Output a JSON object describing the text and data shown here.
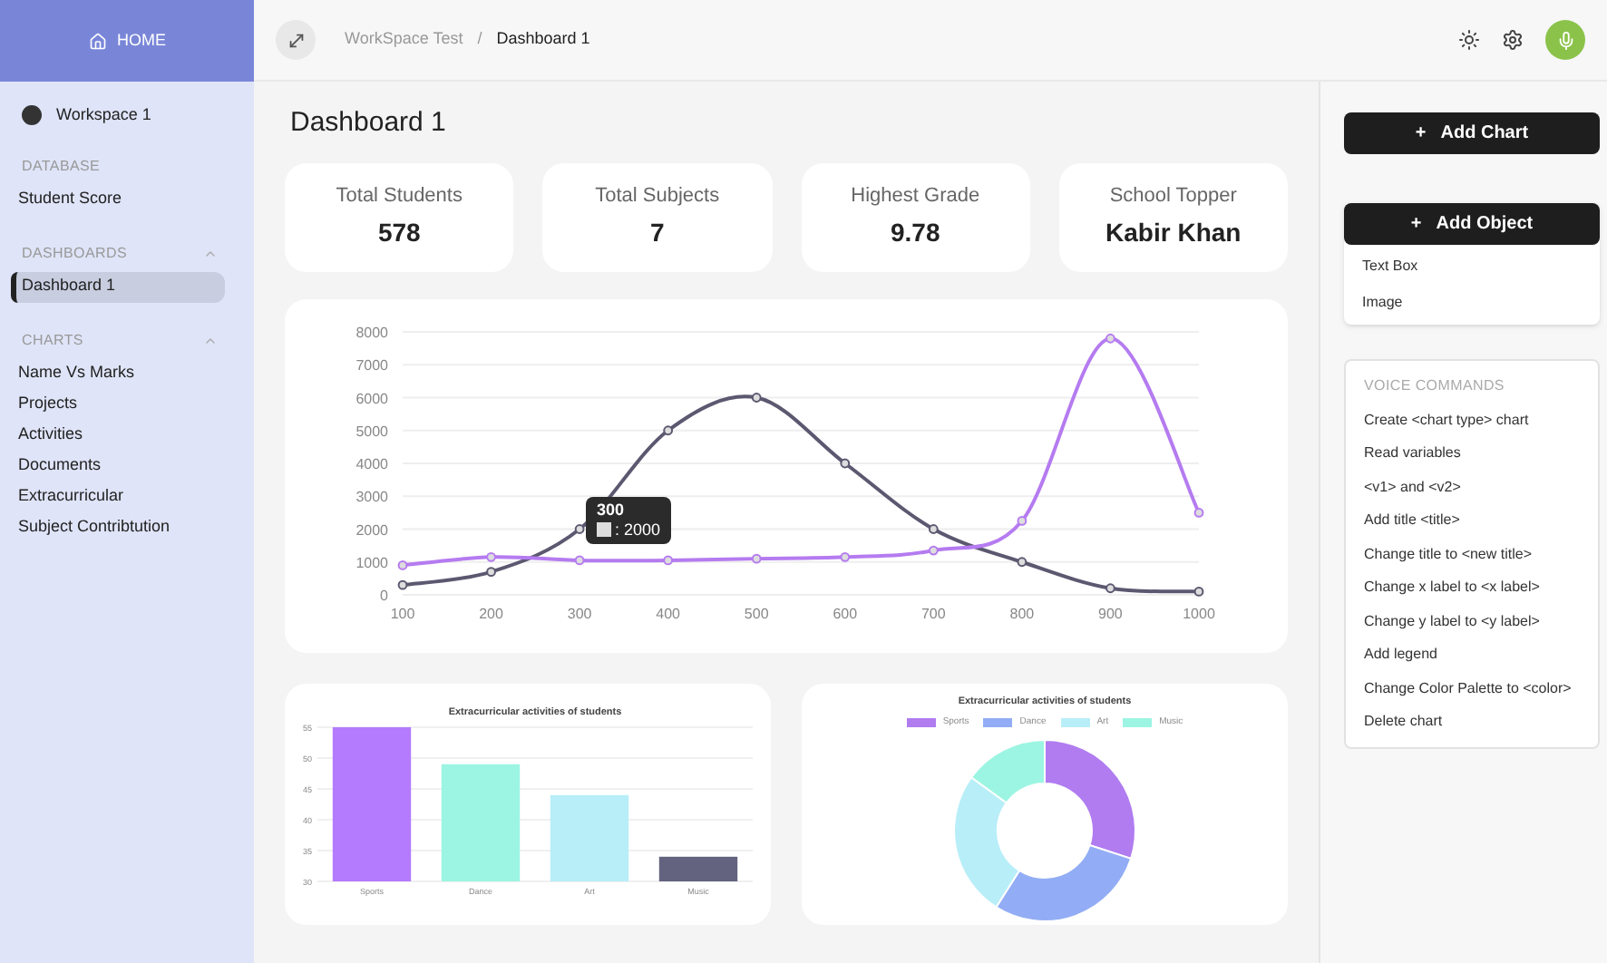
{
  "sidebar": {
    "home": "HOME",
    "workspace": "Workspace 1",
    "sections": [
      {
        "title": "DATABASE",
        "collapsible": false,
        "items": [
          {
            "label": "Student Score",
            "selected": false
          }
        ]
      },
      {
        "title": "DASHBOARDS",
        "collapsible": true,
        "items": [
          {
            "label": "Dashboard 1",
            "selected": true
          }
        ]
      },
      {
        "title": "CHARTS",
        "collapsible": true,
        "items": [
          {
            "label": "Name Vs Marks",
            "selected": false
          },
          {
            "label": "Projects",
            "selected": false
          },
          {
            "label": "Activities",
            "selected": false
          },
          {
            "label": "Documents",
            "selected": false
          },
          {
            "label": "Extracurricular",
            "selected": false
          },
          {
            "label": "Subject Contribtution",
            "selected": false
          }
        ]
      }
    ]
  },
  "breadcrumb": {
    "workspace": "WorkSpace Test",
    "separator": "/",
    "page": "Dashboard 1"
  },
  "page_title": "Dashboard 1",
  "stats": [
    {
      "label": "Total Students",
      "value": "578"
    },
    {
      "label": "Total Subjects",
      "value": "7"
    },
    {
      "label": "Highest Grade",
      "value": "9.78"
    },
    {
      "label": "School Topper",
      "value": "Kabir Khan"
    }
  ],
  "line_chart": {
    "chart_data": {
      "type": "line",
      "grid": true,
      "xlim": [
        100,
        1000
      ],
      "x": [
        100,
        200,
        300,
        400,
        500,
        600,
        700,
        800,
        900,
        1000
      ],
      "xticks": [
        100,
        200,
        300,
        400,
        500,
        600,
        700,
        800,
        900,
        1000
      ],
      "yticks": [
        0,
        1000,
        2000,
        3000,
        4000,
        5000,
        6000,
        7000,
        8000
      ],
      "ylim": [
        0,
        8000
      ],
      "series": [
        {
          "color": "#5b5870",
          "marker": "circle",
          "values": [
            300,
            700,
            2000,
            5000,
            6000,
            4000,
            2000,
            1000,
            200,
            100
          ]
        },
        {
          "color": "#b57bf0",
          "marker": "circle",
          "values": [
            900,
            1150,
            1050,
            1050,
            1100,
            1150,
            1350,
            2250,
            7800,
            2500
          ]
        }
      ]
    },
    "tooltip": {
      "title": "300",
      "value": ": 2000"
    }
  },
  "bar_chart": {
    "chart_data": {
      "type": "bar",
      "grid": true,
      "title": "Extracurricular activities of students",
      "categories": [
        "Sports",
        "Dance",
        "Art",
        "Music"
      ],
      "ylim": [
        30,
        55
      ],
      "yticks": [
        30,
        35,
        40,
        45,
        50,
        55
      ],
      "series": [
        {
          "colors": [
            "#b57bff",
            "#9cf5e2",
            "#b8eef8",
            "#63637f"
          ],
          "values": [
            55,
            49,
            44,
            34
          ]
        }
      ]
    }
  },
  "donut_chart": {
    "title": "Extracurricular activities of students",
    "legend": [
      {
        "label": "Sports",
        "color": "#b07cf0"
      },
      {
        "label": "Dance",
        "color": "#92adf5"
      },
      {
        "label": "Art",
        "color": "#b8eef8"
      },
      {
        "label": "Music",
        "color": "#9cf5e2"
      }
    ]
  },
  "right_panel": {
    "add_chart": "Add Chart",
    "add_object": "Add Object",
    "plus": "+",
    "objects": [
      "Text Box",
      "Image"
    ],
    "voice_title": "VOICE COMMANDS",
    "commands": [
      "Create <chart type> chart",
      "Read variables",
      "<v1> and <v2>",
      "Add title <title>",
      "Change title to <new title>",
      "Change x label to <x label>",
      "Change y label to <y label>",
      "Add legend",
      "Change Color Palette to <color>",
      "Delete chart"
    ]
  }
}
